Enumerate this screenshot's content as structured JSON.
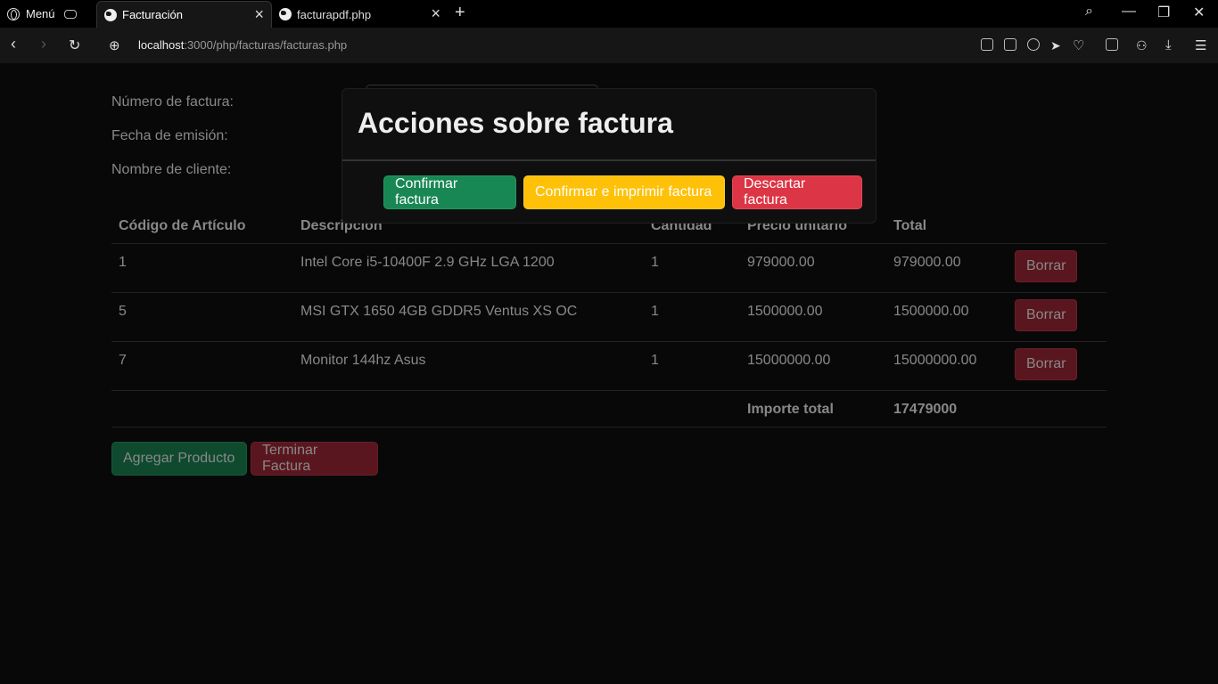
{
  "browser": {
    "menu_label": "Menú",
    "tabs": [
      {
        "label": "Facturación"
      },
      {
        "label": "facturapdf.php"
      }
    ],
    "url_host": "localhost",
    "url_path": ":3000/php/facturas/facturas.php"
  },
  "form": {
    "invoice_number_label": "Número de factura:",
    "issue_date_label": "Fecha de emisión:",
    "client_name_label": "Nombre de cliente:"
  },
  "table": {
    "headers": [
      "Código de Artículo",
      "Descripcion",
      "Cantidad",
      "Precio unitario",
      "Total"
    ],
    "rows": [
      {
        "code": "1",
        "description": "Intel Core i5-10400F 2.9 GHz LGA 1200",
        "qty": "1",
        "unit_price": "979000.00",
        "total": "979000.00",
        "action": "Borrar"
      },
      {
        "code": "5",
        "description": "MSI GTX 1650 4GB GDDR5 Ventus XS OC",
        "qty": "1",
        "unit_price": "1500000.00",
        "total": "1500000.00",
        "action": "Borrar"
      },
      {
        "code": "7",
        "description": "Monitor 144hz Asus",
        "qty": "1",
        "unit_price": "15000000.00",
        "total": "15000000.00",
        "action": "Borrar"
      }
    ],
    "total_label": "Importe total",
    "total_value": "17479000"
  },
  "actions": {
    "add_product": "Agregar Producto",
    "finish_invoice": "Terminar Factura"
  },
  "modal": {
    "title": "Acciones sobre factura",
    "confirm": "Confirmar factura",
    "confirm_print": "Confirmar e imprimir factura",
    "discard": "Descartar factura"
  },
  "colors": {
    "success": "#198754",
    "warning": "#ffc107",
    "danger": "#dc3545"
  }
}
